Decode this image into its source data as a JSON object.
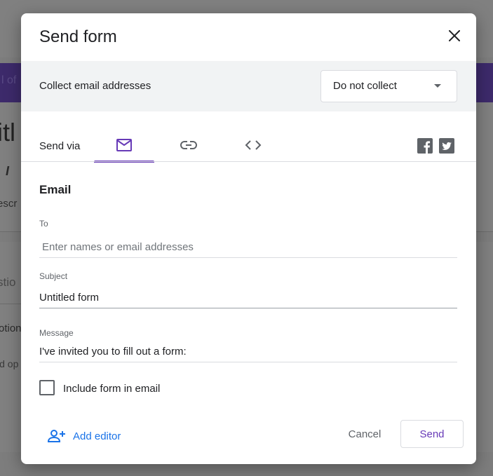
{
  "backdrop": {
    "banner_fragment": "l of",
    "title_fragment": "itl",
    "description_fragment": "escr",
    "question_fragment": "stio",
    "option_fragment": "otion",
    "add_option_fragment": "ld op"
  },
  "dialog": {
    "title": "Send form",
    "close_icon": "close-icon",
    "collect": {
      "label": "Collect email addresses",
      "selected": "Do not collect"
    },
    "send_via": {
      "label": "Send via",
      "tabs": [
        {
          "name": "email",
          "icon": "mail-icon",
          "active": true
        },
        {
          "name": "link",
          "icon": "link-icon",
          "active": false
        },
        {
          "name": "embed",
          "icon": "code-icon",
          "active": false
        }
      ],
      "social": [
        "facebook-icon",
        "twitter-icon"
      ]
    },
    "email": {
      "heading": "Email",
      "to_label": "To",
      "to_placeholder": "Enter names or email addresses",
      "to_value": "",
      "subject_label": "Subject",
      "subject_value": "Untitled form",
      "message_label": "Message",
      "message_value": "I've invited you to fill out a form:",
      "include_label": "Include form in email",
      "include_checked": false
    },
    "footer": {
      "add_editor": "Add editor",
      "cancel": "Cancel",
      "send": "Send"
    }
  },
  "colors": {
    "accent": "#673ab7",
    "link": "#1a73e8",
    "overlay": "#7b7b7b"
  }
}
